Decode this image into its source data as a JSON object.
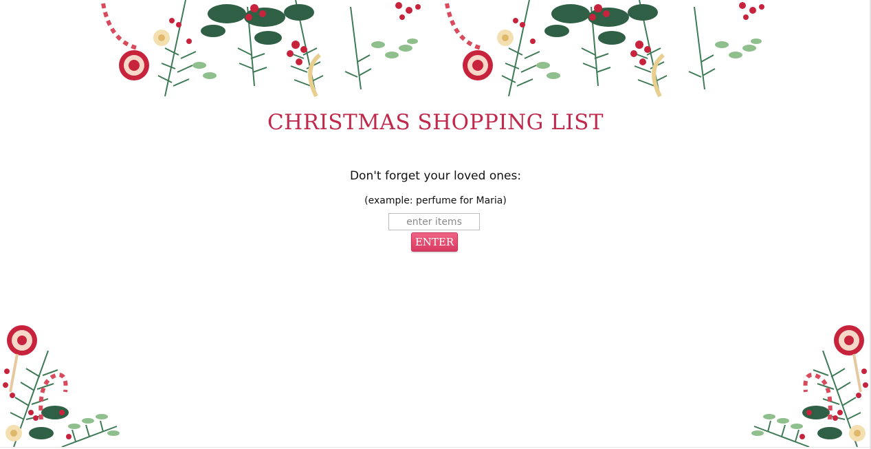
{
  "page": {
    "title": "CHRISTMAS SHOPPING LIST",
    "subtitle": "Don't forget your loved ones:",
    "example": "(example: perfume for Maria)"
  },
  "form": {
    "input_value": "",
    "input_placeholder": "enter items",
    "submit_label": "ENTER"
  },
  "colors": {
    "title": "#c0294b",
    "button": "#e24a6e",
    "pine": "#3e7a55",
    "berry": "#c8233d"
  },
  "decorations": {
    "top_garland": "christmas-garland-icon",
    "bottom_left_corner": "christmas-corner-decoration-icon",
    "bottom_right_corner": "christmas-corner-decoration-icon"
  }
}
